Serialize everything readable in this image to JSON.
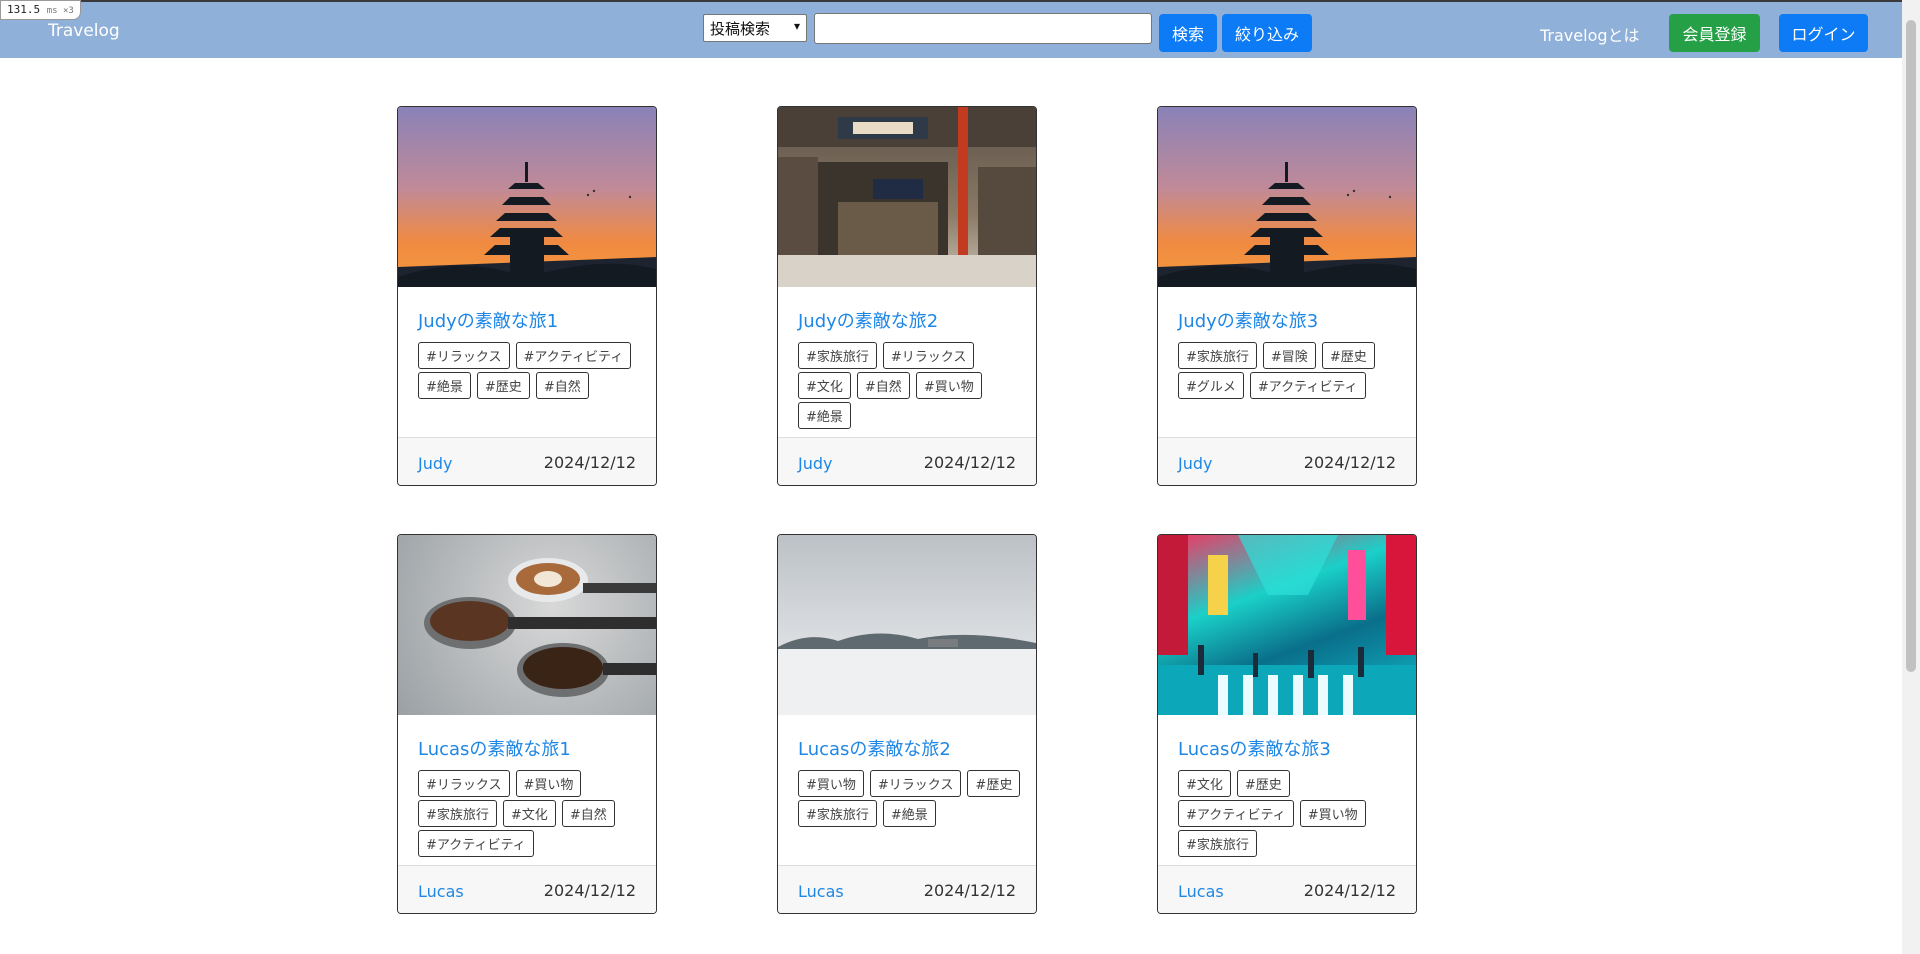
{
  "perf": {
    "value": "131.5",
    "unit": "ms ×3"
  },
  "navbar": {
    "brand": "Travelog",
    "search_select": "投稿検索",
    "search_placeholder": "",
    "search_button": "検索",
    "filter_button": "絞り込み",
    "about_link": "Travelogとは",
    "register_button": "会員登録",
    "login_button": "ログイン"
  },
  "posts": [
    {
      "title": "Judyの素敵な旅1",
      "tags": [
        "#リラックス",
        "#アクティビティ",
        "#絶景",
        "#歴史",
        "#自然"
      ],
      "author": "Judy",
      "date": "2024/12/12",
      "image": "pagoda-sunset"
    },
    {
      "title": "Judyの素敵な旅2",
      "tags": [
        "#家族旅行",
        "#リラックス",
        "#文化",
        "#自然",
        "#買い物",
        "#絶景"
      ],
      "author": "Judy",
      "date": "2024/12/12",
      "image": "japanese-street-shop"
    },
    {
      "title": "Judyの素敵な旅3",
      "tags": [
        "#家族旅行",
        "#冒険",
        "#歴史",
        "#グルメ",
        "#アクティビティ"
      ],
      "author": "Judy",
      "date": "2024/12/12",
      "image": "pagoda-sunset"
    },
    {
      "title": "Lucasの素敵な旅1",
      "tags": [
        "#リラックス",
        "#買い物",
        "#家族旅行",
        "#文化",
        "#自然",
        "#アクティビティ"
      ],
      "author": "Lucas",
      "date": "2024/12/12",
      "image": "coffee"
    },
    {
      "title": "Lucasの素敵な旅2",
      "tags": [
        "#買い物",
        "#リラックス",
        "#歴史",
        "#家族旅行",
        "#絶景"
      ],
      "author": "Lucas",
      "date": "2024/12/12",
      "image": "snow-field"
    },
    {
      "title": "Lucasの素敵な旅3",
      "tags": [
        "#文化",
        "#歴史",
        "#アクティビティ",
        "#買い物",
        "#家族旅行"
      ],
      "author": "Lucas",
      "date": "2024/12/12",
      "image": "neon-city"
    }
  ]
}
